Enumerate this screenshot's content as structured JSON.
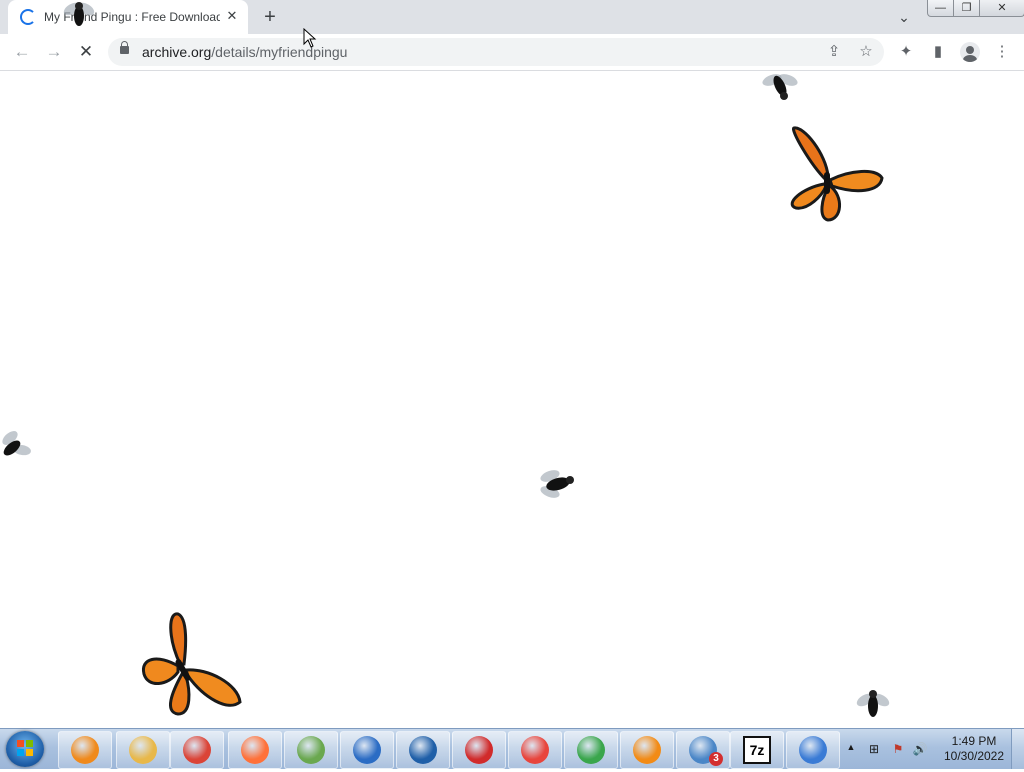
{
  "tab": {
    "title": "My Friend Pingu : Free Download",
    "close_glyph": "✕",
    "new_tab_glyph": "+"
  },
  "window": {
    "tab_search_glyph": "⌄",
    "minimize_glyph": "—",
    "restore_glyph": "❐",
    "close_glyph": "✕"
  },
  "nav": {
    "back_glyph": "←",
    "forward_glyph": "→",
    "stop_glyph": "✕"
  },
  "address": {
    "host": "archive.org",
    "path": "/details/myfriendpingu"
  },
  "toolbar_icons": {
    "share_glyph": "⇪",
    "bookmark_glyph": "☆",
    "extensions_glyph": "✦",
    "side_panel_glyph": "▮",
    "menu_glyph": "⋮"
  },
  "creatures": [
    {
      "kind": "fly",
      "name": "fly-tabbar"
    },
    {
      "kind": "fly",
      "name": "fly-top-right"
    },
    {
      "kind": "butterfly",
      "name": "butterfly-top-right"
    },
    {
      "kind": "fly",
      "name": "fly-left"
    },
    {
      "kind": "fly",
      "name": "fly-center"
    },
    {
      "kind": "butterfly",
      "name": "butterfly-bottom-left"
    },
    {
      "kind": "fly",
      "name": "fly-bottom-right"
    }
  ],
  "taskbar": {
    "pinned": [
      {
        "name": "media-player-icon",
        "color": "#f08a1c"
      },
      {
        "name": "file-explorer-icon",
        "color": "#e8b84a"
      },
      {
        "name": "chrome-icon",
        "color": "#db4437"
      },
      {
        "name": "firefox-icon",
        "color": "#ff7139"
      },
      {
        "name": "green-globe-icon",
        "color": "#6aa84f"
      },
      {
        "name": "shield-check-icon",
        "color": "#2b6cc4"
      },
      {
        "name": "blue-shield-icon",
        "color": "#1f5fa8"
      },
      {
        "name": "red-gear-app-icon",
        "color": "#d12b2b"
      },
      {
        "name": "colorful-squares-icon",
        "color": "#e8453c"
      },
      {
        "name": "stopwatch-icon",
        "color": "#3aa64c"
      },
      {
        "name": "orange-ring-app-icon",
        "color": "#f28b16"
      },
      {
        "name": "search-magnifier-icon",
        "color": "#4a86c7",
        "badge": "3"
      },
      {
        "name": "7zip-icon",
        "label": "7z"
      },
      {
        "name": "network-computer-icon",
        "color": "#3a7bd5"
      }
    ],
    "tray": {
      "expand_glyph": "▲",
      "network_glyph": "⊞",
      "flag_glyph": "⚑",
      "volume_glyph": "🔊"
    },
    "clock": {
      "time": "1:49 PM",
      "date": "10/30/2022"
    }
  }
}
